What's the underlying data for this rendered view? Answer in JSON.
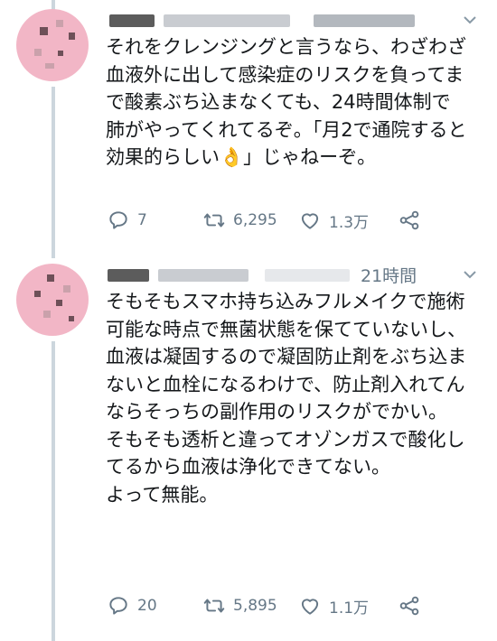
{
  "tweets": [
    {
      "time": "",
      "text": "それをクレンジングと言うなら、わざわざ血液外に出して感染症のリスクを負ってまで酸素ぶち込まなくても、24時間体制で肺がやってくれてるぞ。「月2で通院すると効果的らしい👌」じゃねーぞ。",
      "actions": {
        "reply_count": "7",
        "retweet_count": "6,295",
        "like_count": "1.3万"
      }
    },
    {
      "time": "21時間",
      "text": "そもそもスマホ持ち込みフルメイクで施術可能な時点で無菌状態を保てていないし、\n血液は凝固するので凝固防止剤をぶち込まないと血栓になるわけで、防止剤入れてんならそっちの副作用のリスクがでかい。\nそもそも透析と違ってオゾンガスで酸化してるから血液は浄化できてない。\nよって無能。",
      "actions": {
        "reply_count": "20",
        "retweet_count": "5,895",
        "like_count": "1.1万"
      }
    }
  ],
  "icons": [
    "reply-icon",
    "retweet-icon",
    "like-icon",
    "share-icon",
    "chevron-down-icon"
  ],
  "colors": {
    "secondary_text": "#657786",
    "thread_line": "#ccd6dd",
    "avatar_bg": "#f2b6c6"
  }
}
